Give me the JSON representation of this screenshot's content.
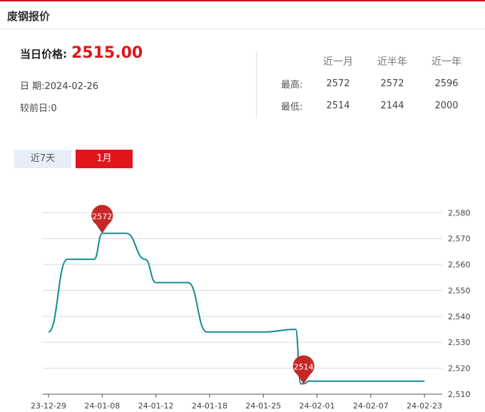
{
  "header": {
    "title": "废钢报价"
  },
  "current": {
    "price_label": "当日价格:",
    "price_value": "2515.00",
    "date_text": "日 期:2024-02-26",
    "change_text": "较前日:0"
  },
  "stats": {
    "columns": [
      "近一月",
      "近半年",
      "近一年"
    ],
    "rows": [
      {
        "label": "最高:",
        "values": [
          "2572",
          "2572",
          "2596"
        ]
      },
      {
        "label": "最低:",
        "values": [
          "2514",
          "2144",
          "2000"
        ]
      }
    ]
  },
  "tabs": [
    {
      "label": "近7天",
      "active": false
    },
    {
      "label": "1月",
      "active": true
    }
  ],
  "colors": {
    "accent": "#e0161c",
    "line": "#128c8c",
    "pin": "#c62828"
  },
  "chart_data": {
    "type": "line",
    "x_ticks": [
      "23-12-29",
      "24-01-08",
      "24-01-12",
      "24-01-18",
      "24-01-25",
      "24-02-01",
      "24-02-07",
      "24-02-23"
    ],
    "y_ticks": [
      2510,
      2520,
      2530,
      2540,
      2550,
      2560,
      2570,
      2580
    ],
    "ylim": [
      2510,
      2582
    ],
    "grid": true,
    "y_axis_side": "right",
    "series": [
      {
        "x": [
          0,
          0.35,
          0.55,
          0.85,
          1.0,
          1.45,
          1.8,
          2.0,
          2.45,
          2.6,
          2.95,
          3.2,
          3.45,
          3.65,
          3.8,
          4.0,
          4.6,
          4.7,
          4.75,
          4.85,
          5.0,
          5.3,
          7.0
        ],
        "values": [
          2534,
          2562,
          2562,
          2562,
          2572,
          2572,
          2562,
          2553,
          2553,
          2553,
          2534,
          2534,
          2534,
          2534,
          2534,
          2534,
          2535,
          2514,
          2514,
          2515,
          2515,
          2515,
          2515
        ]
      }
    ],
    "annotations": [
      {
        "x": 1.0,
        "value": 2572,
        "label": "2572"
      },
      {
        "x": 4.75,
        "value": 2514,
        "label": "2514"
      }
    ]
  }
}
